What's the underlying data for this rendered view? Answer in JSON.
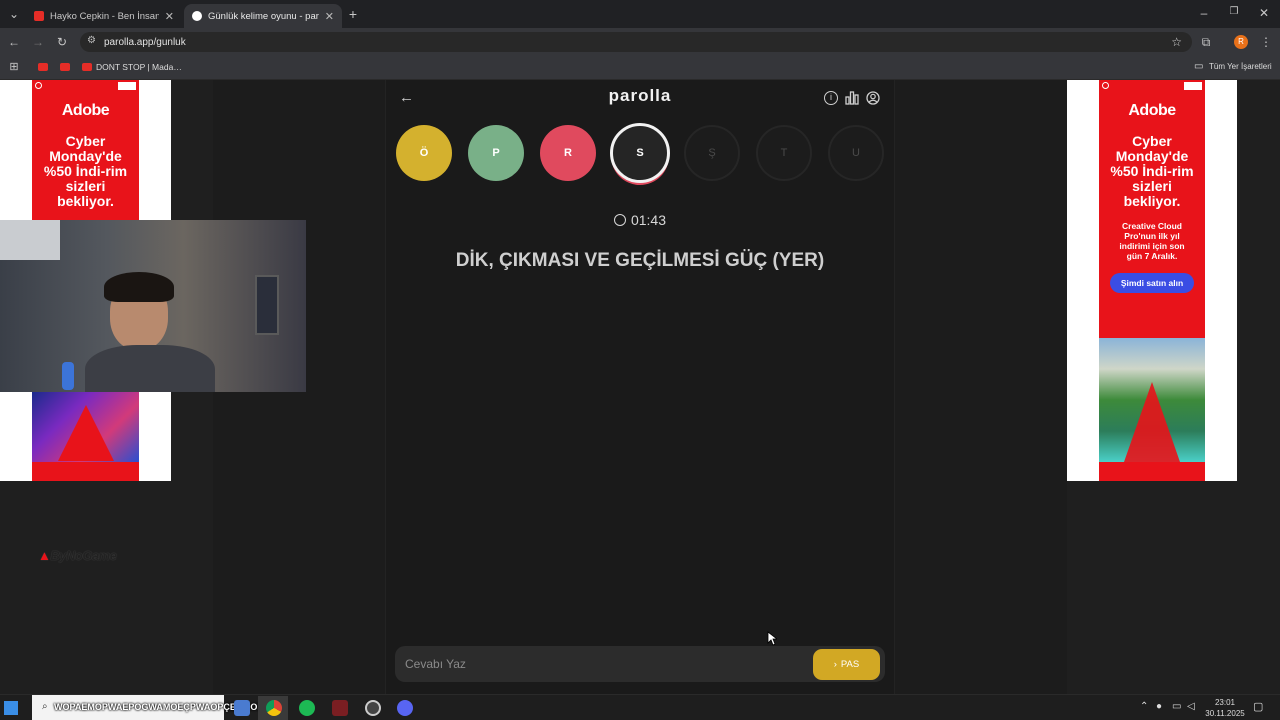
{
  "browser": {
    "tabs": [
      {
        "title": "Hayko Cepkin - Ben İnsan Değ…",
        "favicon_color": "#e52d27"
      },
      {
        "title": "Günlük kelime oyunu - parolla",
        "favicon_color": "#ffffff"
      }
    ],
    "url": "parolla.app/gunluk",
    "bookmarks": [
      {
        "label": "",
        "icon": "youtube-icon"
      },
      {
        "label": "",
        "icon": "youtube-icon"
      },
      {
        "label": "DONT STOP | Mada…",
        "icon": "youtube-icon"
      }
    ],
    "all_bookmarks_label": "Tüm Yer İşaretleri",
    "profile_initial": "R"
  },
  "game": {
    "logo": "parolla",
    "letters": [
      {
        "char": "Ö",
        "state": "correct",
        "color": "#d4b12e"
      },
      {
        "char": "P",
        "state": "answered",
        "color": "#79b088"
      },
      {
        "char": "R",
        "state": "wrong",
        "color": "#e04a5e"
      },
      {
        "char": "S",
        "state": "current",
        "color": "#252525"
      },
      {
        "char": "Ş",
        "state": "pending",
        "color": "#1c1c1c"
      },
      {
        "char": "T",
        "state": "pending",
        "color": "#1c1c1c"
      },
      {
        "char": "U",
        "state": "pending",
        "color": "#1c1c1c"
      }
    ],
    "timer": "01:43",
    "question": "DİK, ÇIKMASI VE GEÇİLMESİ GÜÇ (YER)",
    "answer_placeholder": "Cevabı Yaz",
    "pass_label": "PAS",
    "accent": "#d2a824"
  },
  "ads": {
    "left": {
      "brand": "Adobe",
      "headline": "Cyber Monday'de %50 İndi-rim sizleri bekliyor."
    },
    "right": {
      "brand": "Adobe",
      "headline": "Cyber Monday'de %50 İndi-rim sizleri bekliyor.",
      "sub": "Creative Cloud Pro'nun ilk yıl indirimi için son gün 7 Aralık.",
      "cta": "Şimdi satın alın"
    }
  },
  "watermark": "ByNoGame",
  "taskbar": {
    "marquee": "WOPAEMOPWAEPOGWAMOEÇPWAOPÇEWAOPÇö",
    "clock_time": "23:01",
    "clock_date": "30.11.2025"
  }
}
